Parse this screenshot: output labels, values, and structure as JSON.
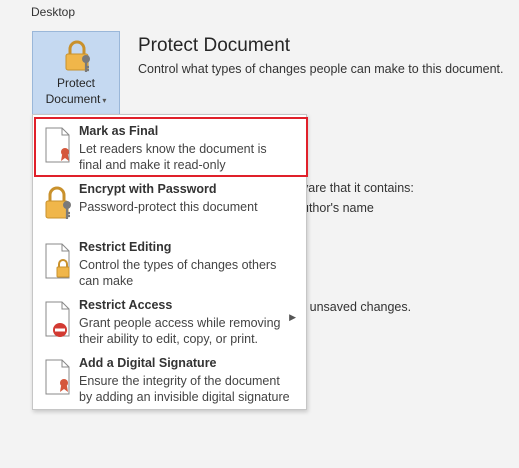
{
  "breadcrumb": "Desktop",
  "protect_button": {
    "line1": "Protect",
    "line2": "Document",
    "caret": "▾"
  },
  "section": {
    "title": "Protect Document",
    "description": "Control what types of changes people can make to this document."
  },
  "background_fragments": {
    "frag1": "vare that it contains:",
    "frag2": "uthor's name",
    "frag3": "r unsaved changes."
  },
  "menu": {
    "items": [
      {
        "title": "Mark as Final",
        "line1": "Let readers know the document is",
        "line2": "final and make it read-only",
        "icon": "mark-as-final-icon"
      },
      {
        "title": "Encrypt with Password",
        "line1": "Password-protect this document",
        "line2": "",
        "icon": "encrypt-password-icon"
      },
      {
        "title": "Restrict Editing",
        "line1": "Control the types of changes others",
        "line2": "can make",
        "icon": "restrict-editing-icon"
      },
      {
        "title": "Restrict Access",
        "line1": "Grant people access while removing",
        "line2": "their ability to edit, copy, or print.",
        "icon": "restrict-access-icon",
        "arrow": "▶"
      },
      {
        "title": "Add a Digital Signature",
        "line1": "Ensure the integrity of the document",
        "line2": "by adding an invisible digital signature",
        "icon": "digital-signature-icon"
      }
    ]
  },
  "colors": {
    "highlight": "#e0202a",
    "button_bg": "#c5d9f1",
    "lock": "#f0b64a"
  }
}
